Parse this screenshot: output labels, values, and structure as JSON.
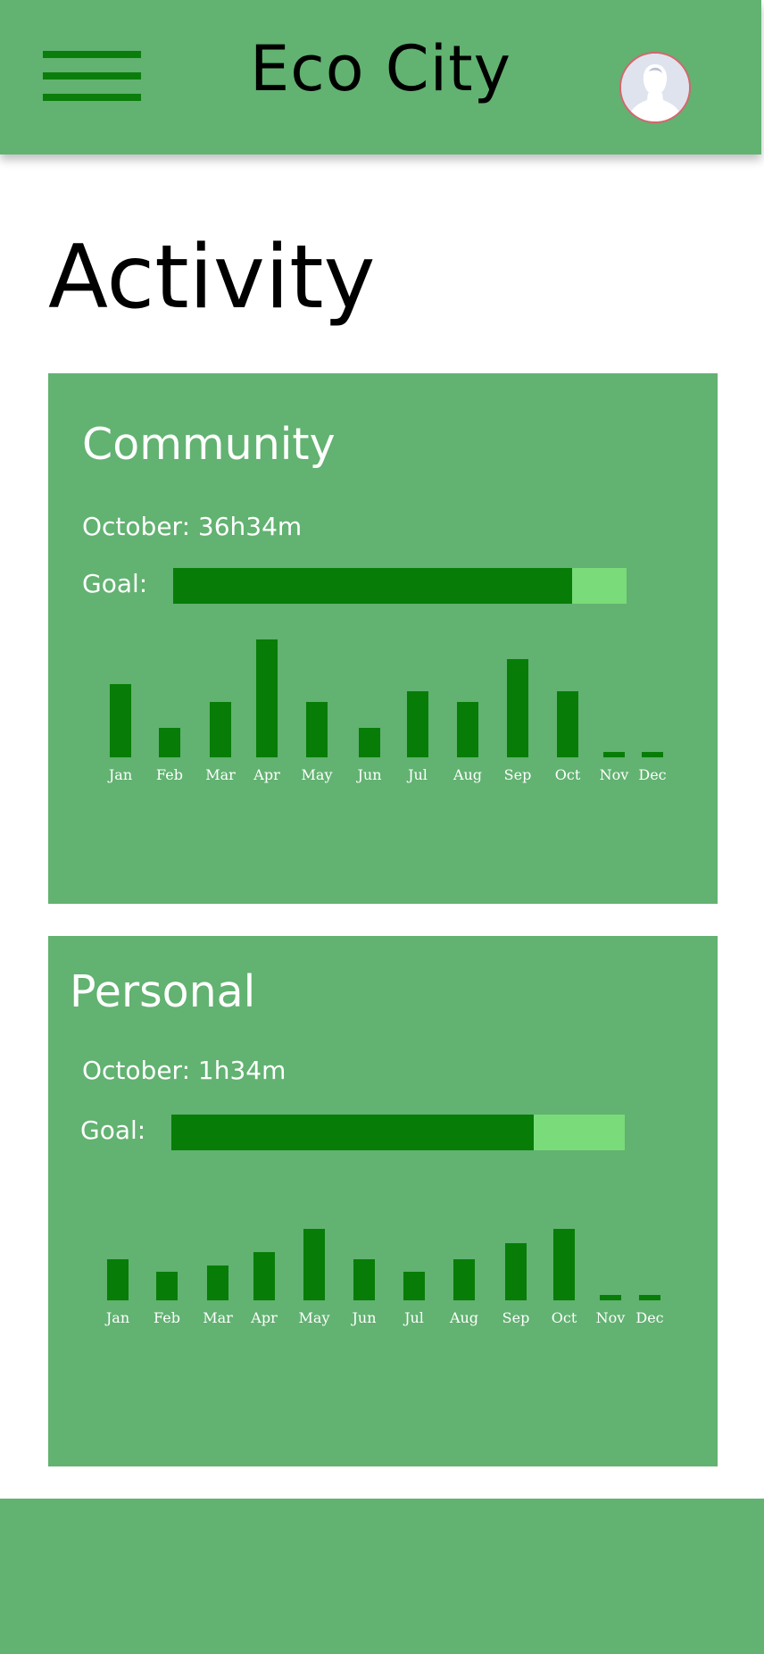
{
  "header": {
    "title": "Eco City",
    "menu_icon": "hamburger-menu-icon",
    "avatar_icon": "user-avatar-icon"
  },
  "page": {
    "title": "Activity"
  },
  "community": {
    "title": "Community",
    "month_total": "October: 36h34m",
    "goal_label": "Goal:",
    "goal_progress": 0.88,
    "months": [
      "Jan",
      "Feb",
      "Mar",
      "Apr",
      "May",
      "Jun",
      "Jul",
      "Aug",
      "Sep",
      "Oct",
      "Nov",
      "Dec"
    ],
    "values": [
      82,
      33,
      62,
      132,
      62,
      33,
      74,
      62,
      110,
      74,
      6,
      6
    ]
  },
  "personal": {
    "title": "Personal",
    "month_total": "October: 1h34m",
    "goal_label": "Goal:",
    "goal_progress": 0.8,
    "months": [
      "Jan",
      "Feb",
      "Mar",
      "Apr",
      "May",
      "Jun",
      "Jul",
      "Aug",
      "Sep",
      "Oct",
      "Nov",
      "Dec"
    ],
    "values": [
      46,
      32,
      39,
      54,
      80,
      46,
      32,
      46,
      64,
      80,
      6,
      6
    ]
  },
  "colors": {
    "brand_green": "#62b271",
    "dark_green": "#077d07",
    "light_green": "#79db79",
    "avatar_border": "#d6656c"
  }
}
